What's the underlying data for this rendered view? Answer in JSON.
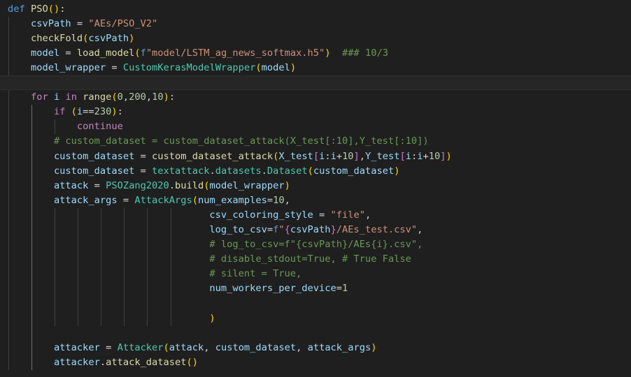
{
  "editor": {
    "language": "python",
    "theme": "dark",
    "lines": [
      [
        [
          "kw",
          "def"
        ],
        [
          "op",
          " "
        ],
        [
          "fn",
          "PSO"
        ],
        [
          "p1",
          "("
        ],
        [
          "p1",
          ")"
        ],
        [
          "op",
          ":"
        ]
      ],
      [
        [
          "op",
          "    "
        ],
        [
          "var",
          "csvPath"
        ],
        [
          "op",
          " = "
        ],
        [
          "str",
          "\"AEs/PSO_V2\""
        ]
      ],
      [
        [
          "op",
          "    "
        ],
        [
          "fn",
          "checkFold"
        ],
        [
          "p1",
          "("
        ],
        [
          "var",
          "csvPath"
        ],
        [
          "p1",
          ")"
        ]
      ],
      [
        [
          "op",
          "    "
        ],
        [
          "var",
          "model"
        ],
        [
          "op",
          " = "
        ],
        [
          "fn",
          "load_model"
        ],
        [
          "p1",
          "("
        ],
        [
          "fpre",
          "f"
        ],
        [
          "str",
          "\"model/LSTM_ag_news_softmax.h5\""
        ],
        [
          "p1",
          ")"
        ],
        [
          "op",
          "  "
        ],
        [
          "com",
          "### 10/3"
        ]
      ],
      [
        [
          "op",
          "    "
        ],
        [
          "var",
          "model_wrapper"
        ],
        [
          "op",
          " = "
        ],
        [
          "cls",
          "CustomKerasModelWrapper"
        ],
        [
          "p1",
          "("
        ],
        [
          "var",
          "model"
        ],
        [
          "p1",
          ")"
        ]
      ],
      [],
      [
        [
          "op",
          "    "
        ],
        [
          "ctl",
          "for"
        ],
        [
          "op",
          " "
        ],
        [
          "var",
          "i"
        ],
        [
          "op",
          " "
        ],
        [
          "ctl",
          "in"
        ],
        [
          "op",
          " "
        ],
        [
          "fn",
          "range"
        ],
        [
          "p1",
          "("
        ],
        [
          "num",
          "0"
        ],
        [
          "op",
          ","
        ],
        [
          "num",
          "200"
        ],
        [
          "op",
          ","
        ],
        [
          "num",
          "10"
        ],
        [
          "p1",
          ")"
        ],
        [
          "op",
          ":"
        ]
      ],
      [
        [
          "op",
          "        "
        ],
        [
          "ctl",
          "if"
        ],
        [
          "op",
          " "
        ],
        [
          "p1",
          "("
        ],
        [
          "var",
          "i"
        ],
        [
          "op",
          "=="
        ],
        [
          "num",
          "230"
        ],
        [
          "p1",
          ")"
        ],
        [
          "op",
          ":"
        ]
      ],
      [
        [
          "op",
          "            "
        ],
        [
          "ctl",
          "continue"
        ]
      ],
      [
        [
          "op",
          "        "
        ],
        [
          "com",
          "# custom_dataset = custom_dataset_attack(X_test[:10],Y_test[:10])"
        ]
      ],
      [
        [
          "op",
          "        "
        ],
        [
          "var",
          "custom_dataset"
        ],
        [
          "op",
          " = "
        ],
        [
          "fn",
          "custom_dataset_attack"
        ],
        [
          "p1",
          "("
        ],
        [
          "var",
          "X_test"
        ],
        [
          "p2",
          "["
        ],
        [
          "var",
          "i"
        ],
        [
          "op",
          ":"
        ],
        [
          "var",
          "i"
        ],
        [
          "op",
          "+"
        ],
        [
          "num",
          "10"
        ],
        [
          "p2",
          "]"
        ],
        [
          "op",
          ","
        ],
        [
          "var",
          "Y_test"
        ],
        [
          "p2",
          "["
        ],
        [
          "var",
          "i"
        ],
        [
          "op",
          ":"
        ],
        [
          "var",
          "i"
        ],
        [
          "op",
          "+"
        ],
        [
          "num",
          "10"
        ],
        [
          "p2",
          "]"
        ],
        [
          "p1",
          ")"
        ]
      ],
      [
        [
          "op",
          "        "
        ],
        [
          "var",
          "custom_dataset"
        ],
        [
          "op",
          " = "
        ],
        [
          "cls",
          "textattack"
        ],
        [
          "op",
          "."
        ],
        [
          "cls",
          "datasets"
        ],
        [
          "op",
          "."
        ],
        [
          "cls",
          "Dataset"
        ],
        [
          "p1",
          "("
        ],
        [
          "var",
          "custom_dataset"
        ],
        [
          "p1",
          ")"
        ]
      ],
      [
        [
          "op",
          "        "
        ],
        [
          "var",
          "attack"
        ],
        [
          "op",
          " = "
        ],
        [
          "cls",
          "PSOZang2020"
        ],
        [
          "op",
          "."
        ],
        [
          "fn",
          "build"
        ],
        [
          "p1",
          "("
        ],
        [
          "var",
          "model_wrapper"
        ],
        [
          "p1",
          ")"
        ]
      ],
      [
        [
          "op",
          "        "
        ],
        [
          "var",
          "attack_args"
        ],
        [
          "op",
          " = "
        ],
        [
          "cls",
          "AttackArgs"
        ],
        [
          "p1",
          "("
        ],
        [
          "var",
          "num_examples"
        ],
        [
          "op",
          "="
        ],
        [
          "num",
          "10"
        ],
        [
          "op",
          ","
        ]
      ],
      [
        [
          "op",
          "                                   "
        ],
        [
          "var",
          "csv_coloring_style"
        ],
        [
          "op",
          " = "
        ],
        [
          "str",
          "\"file\""
        ],
        [
          "op",
          ","
        ]
      ],
      [
        [
          "op",
          "                                   "
        ],
        [
          "var",
          "log_to_csv"
        ],
        [
          "op",
          "="
        ],
        [
          "fpre",
          "f"
        ],
        [
          "str",
          "\""
        ],
        [
          "p2",
          "{"
        ],
        [
          "var",
          "csvPath"
        ],
        [
          "p2",
          "}"
        ],
        [
          "str",
          "/AEs_test.csv\""
        ],
        [
          "op",
          ","
        ]
      ],
      [
        [
          "op",
          "                                   "
        ],
        [
          "com",
          "# log_to_csv=f\"{csvPath}/AEs{i}.csv\","
        ]
      ],
      [
        [
          "op",
          "                                   "
        ],
        [
          "com",
          "# disable_stdout=True, # True False"
        ]
      ],
      [
        [
          "op",
          "                                   "
        ],
        [
          "com",
          "# silent = True,"
        ]
      ],
      [
        [
          "op",
          "                                   "
        ],
        [
          "var",
          "num_workers_per_device"
        ],
        [
          "op",
          "="
        ],
        [
          "num",
          "1"
        ]
      ],
      [],
      [
        [
          "op",
          "                                   "
        ],
        [
          "p1",
          ")"
        ]
      ],
      [],
      [
        [
          "op",
          "        "
        ],
        [
          "var",
          "attacker"
        ],
        [
          "op",
          " = "
        ],
        [
          "cls",
          "Attacker"
        ],
        [
          "p1",
          "("
        ],
        [
          "var",
          "attack"
        ],
        [
          "op",
          ", "
        ],
        [
          "var",
          "custom_dataset"
        ],
        [
          "op",
          ", "
        ],
        [
          "var",
          "attack_args"
        ],
        [
          "p1",
          ")"
        ]
      ],
      [
        [
          "op",
          "        "
        ],
        [
          "var",
          "attacker"
        ],
        [
          "op",
          "."
        ],
        [
          "fn",
          "attack_dataset"
        ],
        [
          "p1",
          "("
        ],
        [
          "p1",
          ")"
        ]
      ]
    ]
  }
}
